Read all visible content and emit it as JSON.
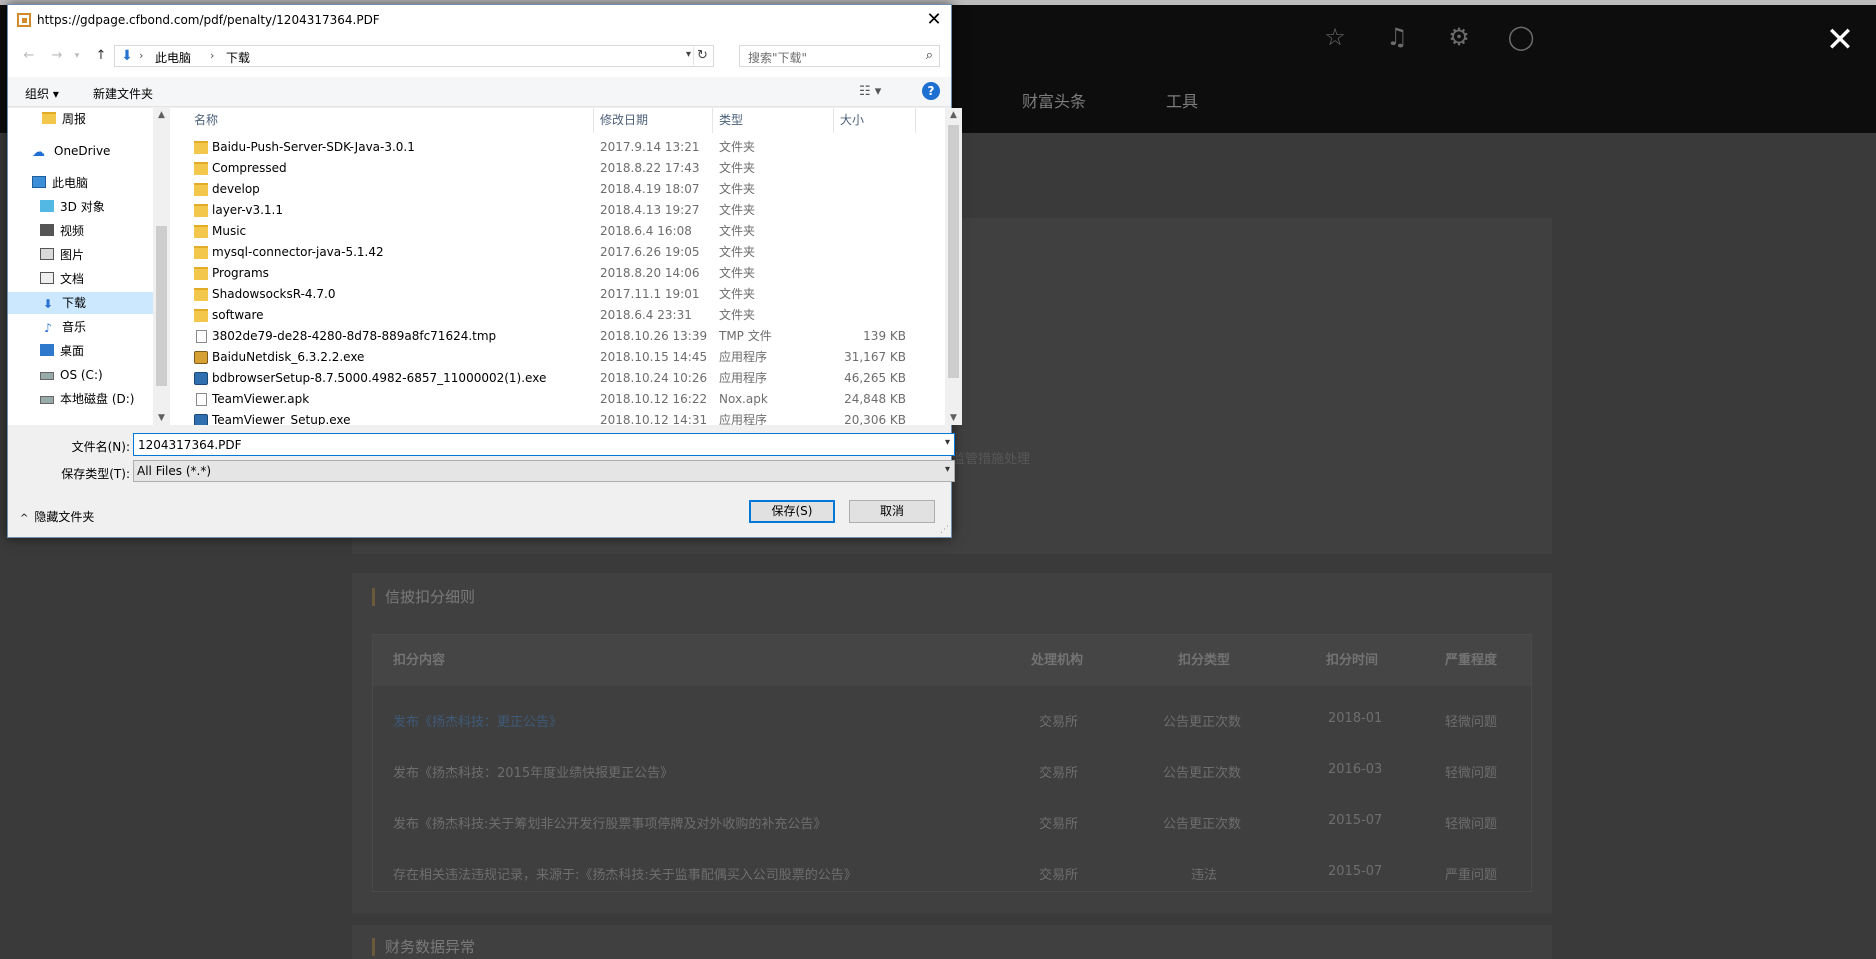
{
  "background": {
    "nav_items": [
      "财富头条",
      "工具"
    ],
    "section_title": "信披扣分细则",
    "section_title_2": "财务数据异常",
    "faint_text": "监管措施处理",
    "table": {
      "headers": [
        "扣分内容",
        "处理机构",
        "扣分类型",
        "扣分时间",
        "严重程度"
      ],
      "rows": [
        [
          "发布《扬杰科技：更正公告》",
          "交易所",
          "公告更正次数",
          "2018-01",
          "轻微问题"
        ],
        [
          "发布《扬杰科技：2015年度业绩快报更正公告》",
          "交易所",
          "公告更正次数",
          "2016-03",
          "轻微问题"
        ],
        [
          "发布《扬杰科技:关于筹划非公开发行股票事项停牌及对外收购的补充公告》",
          "交易所",
          "公告更正次数",
          "2015-07",
          "轻微问题"
        ],
        [
          "存在相关违法违规记录，来源于:《扬杰科技:关于监事配偶买入公司股票的公告》",
          "交易所",
          "违法",
          "2015-07",
          "严重问题"
        ]
      ]
    },
    "close_glyph": "✕"
  },
  "dialog": {
    "title": "https://gdpage.cfbond.com/pdf/penalty/1204317364.PDF",
    "address": {
      "root": "此电脑",
      "folder": "下载"
    },
    "search_placeholder": "搜索\"下载\"",
    "toolbar": {
      "organize": "组织 ▾",
      "new_folder": "新建文件夹"
    },
    "sidebar": [
      {
        "label": "周报",
        "icon": "folder"
      },
      {
        "label": "OneDrive",
        "icon": "cloud"
      },
      {
        "label": "此电脑",
        "icon": "pc"
      },
      {
        "label": "3D 对象",
        "icon": "3d"
      },
      {
        "label": "视频",
        "icon": "video"
      },
      {
        "label": "图片",
        "icon": "pic"
      },
      {
        "label": "文档",
        "icon": "doc"
      },
      {
        "label": "下载",
        "icon": "dl"
      },
      {
        "label": "音乐",
        "icon": "music"
      },
      {
        "label": "桌面",
        "icon": "desk"
      },
      {
        "label": "OS (C:)",
        "icon": "drive"
      },
      {
        "label": "本地磁盘 (D:)",
        "icon": "drive"
      }
    ],
    "columns": {
      "name": "名称",
      "date": "修改日期",
      "type": "类型",
      "size": "大小"
    },
    "files": [
      {
        "name": "Baidu-Push-Server-SDK-Java-3.0.1",
        "date": "2017.9.14 13:21",
        "type": "文件夹",
        "size": "",
        "icon": "folder"
      },
      {
        "name": "Compressed",
        "date": "2018.8.22 17:43",
        "type": "文件夹",
        "size": "",
        "icon": "folder"
      },
      {
        "name": "develop",
        "date": "2018.4.19 18:07",
        "type": "文件夹",
        "size": "",
        "icon": "folder"
      },
      {
        "name": "layer-v3.1.1",
        "date": "2018.4.13 19:27",
        "type": "文件夹",
        "size": "",
        "icon": "folder"
      },
      {
        "name": "Music",
        "date": "2018.6.4 16:08",
        "type": "文件夹",
        "size": "",
        "icon": "folder"
      },
      {
        "name": "mysql-connector-java-5.1.42",
        "date": "2017.6.26 19:05",
        "type": "文件夹",
        "size": "",
        "icon": "folder"
      },
      {
        "name": "Programs",
        "date": "2018.8.20 14:06",
        "type": "文件夹",
        "size": "",
        "icon": "folder"
      },
      {
        "name": "ShadowsocksR-4.7.0",
        "date": "2017.11.1 19:01",
        "type": "文件夹",
        "size": "",
        "icon": "folder"
      },
      {
        "name": "software",
        "date": "2018.6.4 23:31",
        "type": "文件夹",
        "size": "",
        "icon": "folder"
      },
      {
        "name": "3802de79-de28-4280-8d78-889a8fc71624.tmp",
        "date": "2018.10.26 13:39",
        "type": "TMP 文件",
        "size": "139 KB",
        "icon": "file"
      },
      {
        "name": "BaiduNetdisk_6.3.2.2.exe",
        "date": "2018.10.15 14:45",
        "type": "应用程序",
        "size": "31,167 KB",
        "icon": "exe"
      },
      {
        "name": "bdbrowserSetup-8.7.5000.4982-6857_11000002(1).exe",
        "date": "2018.10.24 10:26",
        "type": "应用程序",
        "size": "46,265 KB",
        "icon": "exe2"
      },
      {
        "name": "TeamViewer.apk",
        "date": "2018.10.12 16:22",
        "type": "Nox.apk",
        "size": "24,848 KB",
        "icon": "file"
      },
      {
        "name": "TeamViewer_Setup.exe",
        "date": "2018.10.12 14:31",
        "type": "应用程序",
        "size": "20,306 KB",
        "icon": "exe2"
      }
    ],
    "filename_label": "文件名(N):",
    "filename_value": "1204317364.PDF",
    "filetype_label": "保存类型(T):",
    "filetype_value": "All Files (*.*)",
    "hide_folders": "隐藏文件夹",
    "save_button": "保存(S)",
    "cancel_button": "取消"
  }
}
